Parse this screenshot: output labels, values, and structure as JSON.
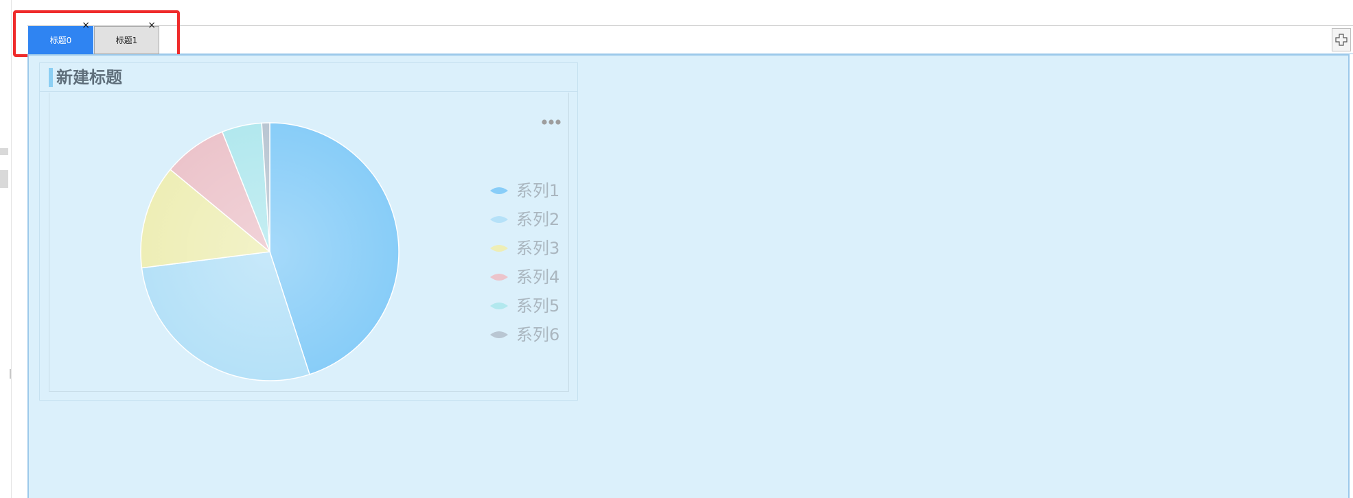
{
  "tabs": [
    {
      "label": "标题0",
      "active": true,
      "close": "×"
    },
    {
      "label": "标题1",
      "active": false,
      "close": "×"
    }
  ],
  "widget": {
    "title": "新建标题"
  },
  "chart_data": {
    "type": "pie",
    "series": [
      {
        "name": "系列1",
        "value": 45,
        "color": "#88cdf8"
      },
      {
        "name": "系列2",
        "value": 28,
        "color": "#b5e1f8"
      },
      {
        "name": "系列3",
        "value": 13,
        "color": "#eeeeb6"
      },
      {
        "name": "系列4",
        "value": 8,
        "color": "#ecc4cb"
      },
      {
        "name": "系列5",
        "value": 5,
        "color": "#b2e8ee"
      },
      {
        "name": "系列6",
        "value": 1,
        "color": "#b9c6d2"
      }
    ]
  },
  "colors": {
    "accent": "#2f84f2",
    "highlight": "#ef2b2b",
    "panel": "#dbf0fb"
  },
  "icons": {
    "add": "plus-icon",
    "more": "more-icon"
  }
}
